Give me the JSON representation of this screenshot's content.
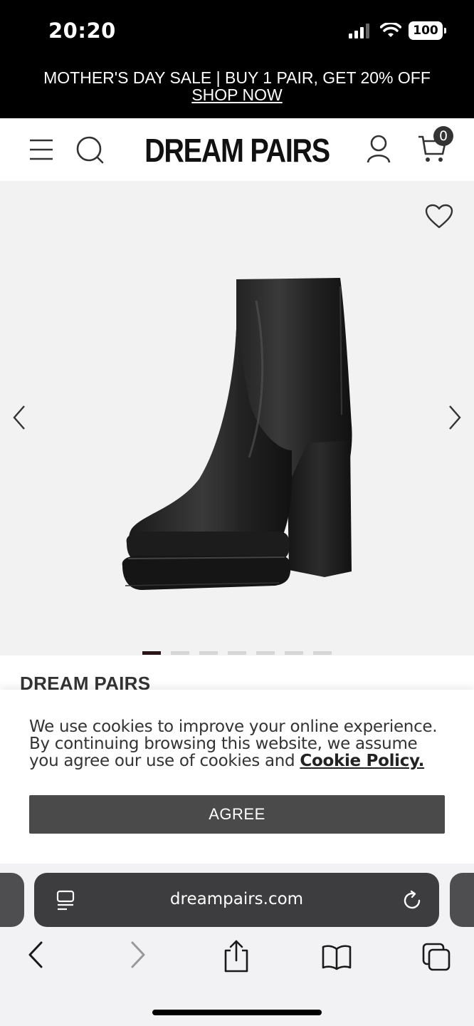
{
  "status_bar": {
    "time": "20:20",
    "battery": "100"
  },
  "promo": {
    "text": "MOTHER'S DAY SALE | BUY 1 PAIR, GET 20% OFF ",
    "link": "SHOP NOW"
  },
  "header": {
    "logo": "DREAM PAIRS",
    "cart_count": "0"
  },
  "gallery": {
    "image_count": 7,
    "active_index": 0
  },
  "product": {
    "brand": "DREAM PAIRS"
  },
  "cookie": {
    "text": "We use cookies to improve your online experience. By continuing browsing this website, we assume you agree our use of cookies and ",
    "policy_link": "Cookie Policy.",
    "agree_label": "AGREE"
  },
  "browser": {
    "url": "dreampairs.com"
  },
  "colors": {
    "banner_bg": "#000000",
    "gallery_bg": "#f2f2f2",
    "agree_button": "#4a4a4a",
    "active_dot": "#2b1519"
  }
}
